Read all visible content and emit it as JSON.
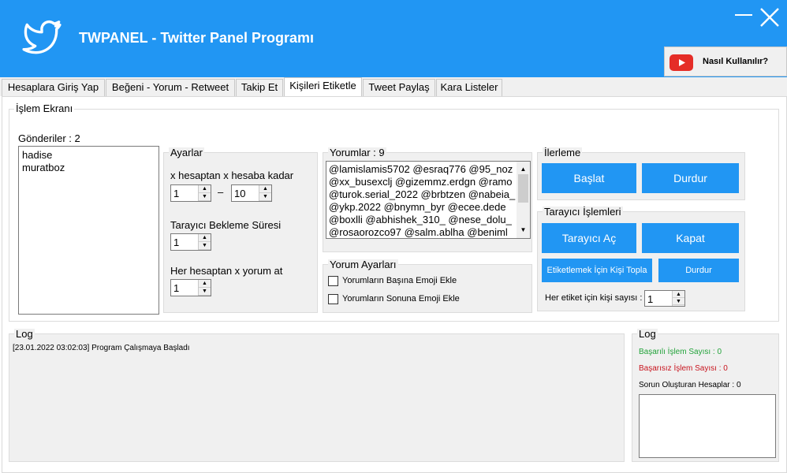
{
  "app": {
    "title": "TWPANEL - Twitter Panel Programı",
    "help_button": "Nasıl Kullanılır?"
  },
  "tabs": [
    "Hesaplara Giriş Yap",
    "Beğeni - Yorum - Retweet",
    "Takip Et",
    "Kişileri Etiketle",
    "Tweet Paylaş",
    "Kara Listeler"
  ],
  "islem": {
    "title": "İşlem Ekranı",
    "senders_label": "Gönderiler : 2",
    "senders": [
      "hadise",
      "muratboz"
    ]
  },
  "ayarlar": {
    "title": "Ayarlar",
    "range_label": "x hesaptan x hesaba kadar",
    "range_from": "1",
    "range_sep": "–",
    "range_to": "10",
    "wait_label": "Tarayıcı Bekleme Süresi",
    "wait_value": "1",
    "comment_label": "Her hesaptan x yorum at",
    "comment_value": "1"
  },
  "yorumlar": {
    "title": "Yorumlar : 9",
    "lines": [
      "@lamislamis5702 @esraq776 @95_noz",
      "@xx_busexclj @gizemmz.erdgn @ramo",
      "@turok.serial_2022 @brbtzen @nabeia_",
      "@ykp.2022 @bnymn_byr @ecee.dede",
      "@boxlli @abhishek_310_ @nese_dolu_",
      "@rosaorozco97 @salm.ablha @beniml"
    ]
  },
  "yorum_ayarlari": {
    "title": "Yorum Ayarları",
    "emoji_start": "Yorumların Başına Emoji Ekle",
    "emoji_end": "Yorumların Sonuna Emoji Ekle"
  },
  "ilerleme": {
    "title": "İlerleme",
    "start": "Başlat",
    "stop": "Durdur"
  },
  "tarayici": {
    "title": "Tarayıcı İşlemleri",
    "open": "Tarayıcı Aç",
    "close": "Kapat",
    "collect": "Etiketlemek İçin Kişi Topla",
    "stop": "Durdur",
    "per_tag_label": "Her etiket için kişi sayısı :",
    "per_tag_value": "1"
  },
  "log": {
    "title": "Log",
    "entry": "[23.01.2022 03:02:03] Program Çalışmaya Başladı"
  },
  "log2": {
    "title": "Log",
    "success": "Başarılı İşlem Sayısı : 0",
    "fail": "Başarısız İşlem Sayısı : 0",
    "problem": "Sorun Oluşturan Hesaplar : 0"
  },
  "colors": {
    "accent": "#2196f3",
    "success": "#22a33a",
    "fail": "#c8141e",
    "youtube": "#e52d27"
  },
  "icons": {
    "logo": "twitter-bird-icon",
    "youtube": "youtube-play-icon"
  }
}
